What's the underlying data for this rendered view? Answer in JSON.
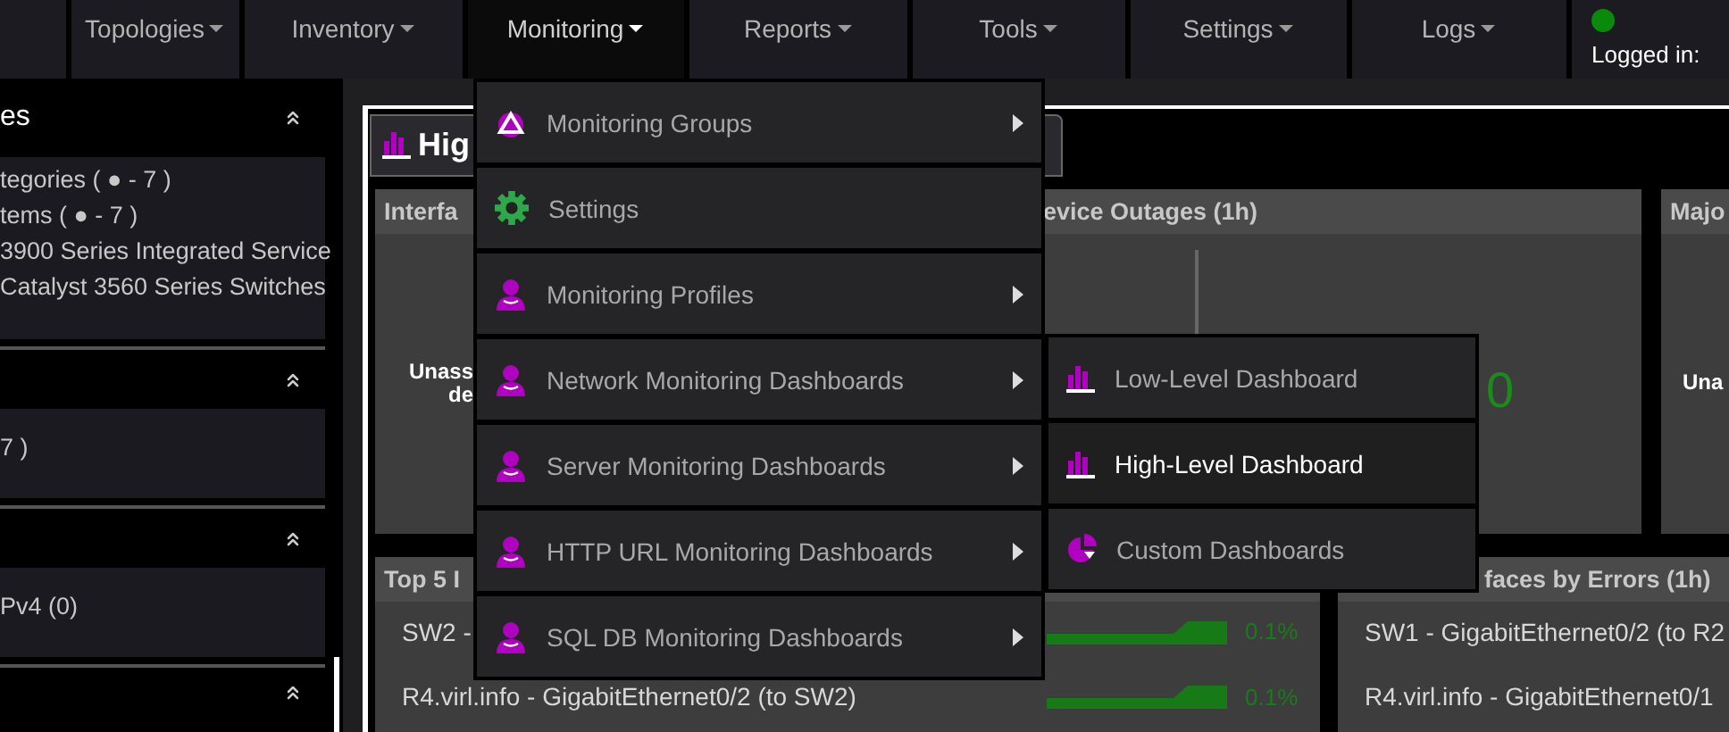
{
  "navbar": {
    "items": [
      {
        "label": "Topologies",
        "selected": false
      },
      {
        "label": "Inventory",
        "selected": false
      },
      {
        "label": "Monitoring",
        "selected": true
      },
      {
        "label": "Reports",
        "selected": false
      },
      {
        "label": "Tools",
        "selected": false
      },
      {
        "label": "Settings",
        "selected": false
      },
      {
        "label": "Logs",
        "selected": false
      }
    ],
    "user": {
      "online": true,
      "text": "Logged in:"
    }
  },
  "sidebar": {
    "sections": [
      {
        "title": "es",
        "expanded": true,
        "items": [
          "tegories ( ● - 7 )",
          "tems ( ● - 7 )",
          "3900 Series Integrated Service",
          "Catalyst 3560 Series Switches"
        ]
      },
      {
        "expanded": true,
        "items": [
          "7 )"
        ]
      },
      {
        "expanded": true,
        "items": [
          "Pv4 (0)"
        ]
      },
      {
        "expanded": true
      }
    ]
  },
  "dashboard": {
    "title": "Hig",
    "top_widgets": [
      {
        "kind": "text",
        "title": "Interfa",
        "lines": [
          "Unass",
          "de"
        ]
      },
      {
        "kind": "count",
        "title": "evice Outages (1h)",
        "value": "0"
      },
      {
        "kind": "text",
        "title": "Majo",
        "lines": [
          "Una"
        ]
      }
    ],
    "bottom_widgets": [
      {
        "title": "Top 5 I",
        "rows": [
          {
            "label": "SW2 -",
            "reading": "0.1%"
          },
          {
            "label": "R4.virl.info - GigabitEthernet0/2 (to SW2)",
            "reading": "0.1%"
          }
        ]
      },
      {
        "title": "faces by Errors (1h)",
        "rows": [
          {
            "label": "SW1 - GigabitEthernet0/2 (to R2"
          },
          {
            "label": "R4.virl.info - GigabitEthernet0/1"
          }
        ]
      }
    ]
  },
  "menu": {
    "items": [
      {
        "label": "Monitoring Groups",
        "kind": "groups",
        "submenu": true
      },
      {
        "label": "Settings",
        "kind": "settings",
        "submenu": false
      },
      {
        "label": "Monitoring Profiles",
        "kind": "profile",
        "submenu": true
      },
      {
        "label": "Network Monitoring Dashboards",
        "kind": "profile",
        "submenu": true
      },
      {
        "label": "Server Monitoring Dashboards",
        "kind": "profile",
        "submenu": true
      },
      {
        "label": "HTTP URL Monitoring Dashboards",
        "kind": "profile",
        "submenu": true
      },
      {
        "label": "SQL DB Monitoring Dashboards",
        "kind": "profile",
        "submenu": true
      }
    ]
  },
  "submenu": {
    "items": [
      {
        "label": "Low-Level Dashboard",
        "kind": "dashboard",
        "selected": false
      },
      {
        "label": "High-Level Dashboard",
        "kind": "dashboard",
        "selected": true
      },
      {
        "label": "Custom Dashboards",
        "kind": "custom",
        "selected": false
      }
    ]
  }
}
